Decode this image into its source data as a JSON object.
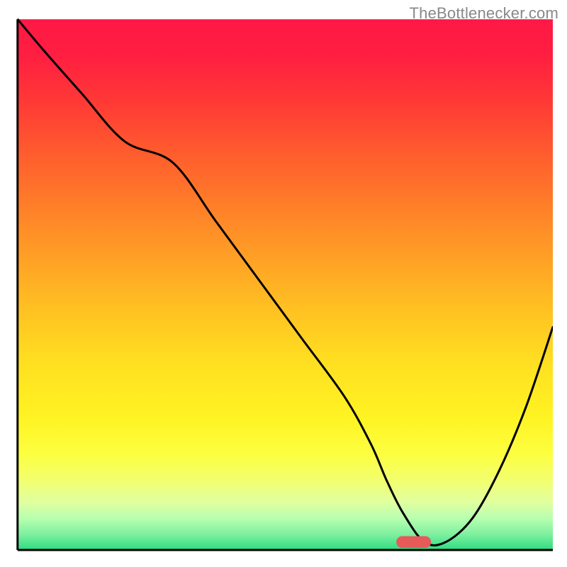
{
  "attribution": "TheBottlenecker.com",
  "chart_data": {
    "type": "line",
    "title": "",
    "xlabel": "",
    "ylabel": "",
    "xlim": [
      0,
      100
    ],
    "ylim": [
      0,
      100
    ],
    "background_gradient": {
      "stops": [
        {
          "offset": 0.0,
          "color": "#ff1846"
        },
        {
          "offset": 0.07,
          "color": "#ff1f41"
        },
        {
          "offset": 0.15,
          "color": "#ff3736"
        },
        {
          "offset": 0.25,
          "color": "#ff5b2e"
        },
        {
          "offset": 0.35,
          "color": "#ff7e29"
        },
        {
          "offset": 0.45,
          "color": "#ffa025"
        },
        {
          "offset": 0.55,
          "color": "#ffc222"
        },
        {
          "offset": 0.65,
          "color": "#ffe021"
        },
        {
          "offset": 0.75,
          "color": "#fff323"
        },
        {
          "offset": 0.82,
          "color": "#fcff40"
        },
        {
          "offset": 0.87,
          "color": "#f2ff70"
        },
        {
          "offset": 0.91,
          "color": "#e0ffa0"
        },
        {
          "offset": 0.94,
          "color": "#b8ffb0"
        },
        {
          "offset": 0.97,
          "color": "#80f0a0"
        },
        {
          "offset": 1.0,
          "color": "#2edc82"
        }
      ]
    },
    "series": [
      {
        "name": "bottleneck-curve",
        "color": "#000000",
        "stroke_width": 3,
        "x": [
          0,
          5,
          12,
          20,
          29,
          37,
          45,
          53,
          61,
          66,
          69,
          72,
          76,
          80,
          85,
          90,
          95,
          100
        ],
        "values": [
          100,
          94,
          86,
          77,
          73,
          62,
          51,
          40,
          29,
          20,
          13,
          7,
          1.5,
          1.5,
          6,
          15,
          27,
          42
        ]
      }
    ],
    "marker": {
      "name": "optimal-marker",
      "x": 74,
      "y": 1.5,
      "width": 6.5,
      "height": 2.2,
      "color": "#e65a5a"
    },
    "axes": {
      "color": "#000000",
      "stroke_width": 3,
      "left_x": 3.1,
      "bottom_y": 3.0,
      "inner_top_y": 96.6,
      "inner_right_x": 97.5
    }
  }
}
